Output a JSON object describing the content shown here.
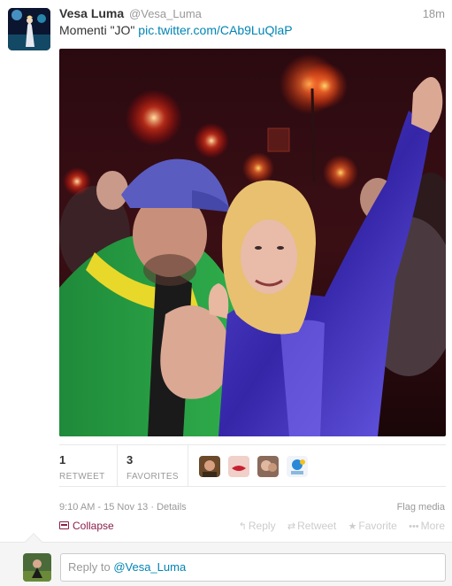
{
  "tweet": {
    "fullname": "Vesa Luma",
    "username": "@Vesa_Luma",
    "time": "18m",
    "text": "Momenti \"JO\"",
    "link": "pic.twitter.com/CAb9LuQlaP"
  },
  "stats": {
    "retweets": "1",
    "retweets_label": "RETWEET",
    "favorites": "3",
    "favorites_label": "FAVORITES"
  },
  "meta": {
    "timestamp": "9:10 AM - 15 Nov 13",
    "separator": " · ",
    "details": "Details",
    "flag": "Flag media"
  },
  "actions": {
    "collapse": "Collapse",
    "reply": "Reply",
    "retweet": "Retweet",
    "favorite": "Favorite",
    "more": "More"
  },
  "reply": {
    "prefix": "Reply to ",
    "handle": "@Vesa_Luma"
  },
  "colors": {
    "link": "#0084b4",
    "collapse": "#8b1f4a",
    "muted": "#999999"
  }
}
